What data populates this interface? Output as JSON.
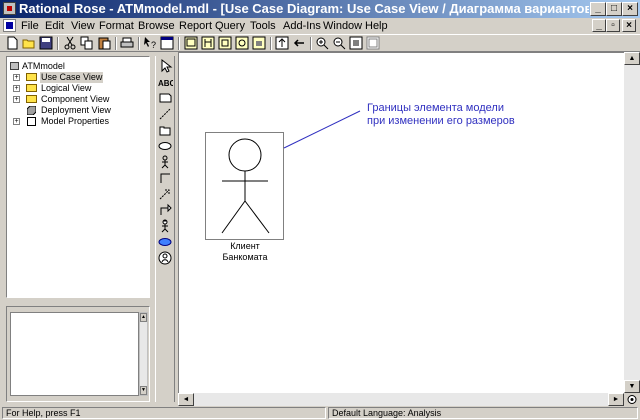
{
  "window": {
    "title": "Rational Rose - ATMmodel.mdl - [Use Case Diagram: Use Case View / Диаграмма вариантов ис..."
  },
  "menu": {
    "items": [
      "File",
      "Edit",
      "View",
      "Format",
      "Browse",
      "Report",
      "Query",
      "Tools",
      "Add-Ins",
      "Window",
      "Help"
    ]
  },
  "browser": {
    "root": "ATMmodel",
    "items": [
      {
        "label": "Use Case View",
        "expander": "+",
        "selected": true,
        "icon": "folder-icon"
      },
      {
        "label": "Logical View",
        "expander": "+",
        "selected": false,
        "icon": "folder-icon"
      },
      {
        "label": "Component View",
        "expander": "+",
        "selected": false,
        "icon": "folder-icon"
      },
      {
        "label": "Deployment View",
        "expander": "",
        "selected": false,
        "icon": "deployment-icon"
      },
      {
        "label": "Model Properties",
        "expander": "+",
        "selected": false,
        "icon": "properties-icon"
      }
    ]
  },
  "toolbox": {
    "tools": [
      "pointer-icon",
      "text-box-icon",
      "note-icon",
      "anchor-note-icon",
      "package-icon",
      "use-case-icon",
      "actor-icon",
      "unidirectional-association-icon",
      "dependency-icon",
      "generalization-icon",
      "business-actor-icon",
      "business-use-case-icon",
      "business-worker-icon"
    ]
  },
  "diagram": {
    "actor_label_line1": "Клиент",
    "actor_label_line2": "Банкомата",
    "annotation_line1": "Границы элемента модели",
    "annotation_line2": "при изменении его размеров",
    "annotation_color": "#3030c0"
  },
  "status": {
    "help": "For Help, press F1",
    "language": "Default Language: Analysis"
  }
}
